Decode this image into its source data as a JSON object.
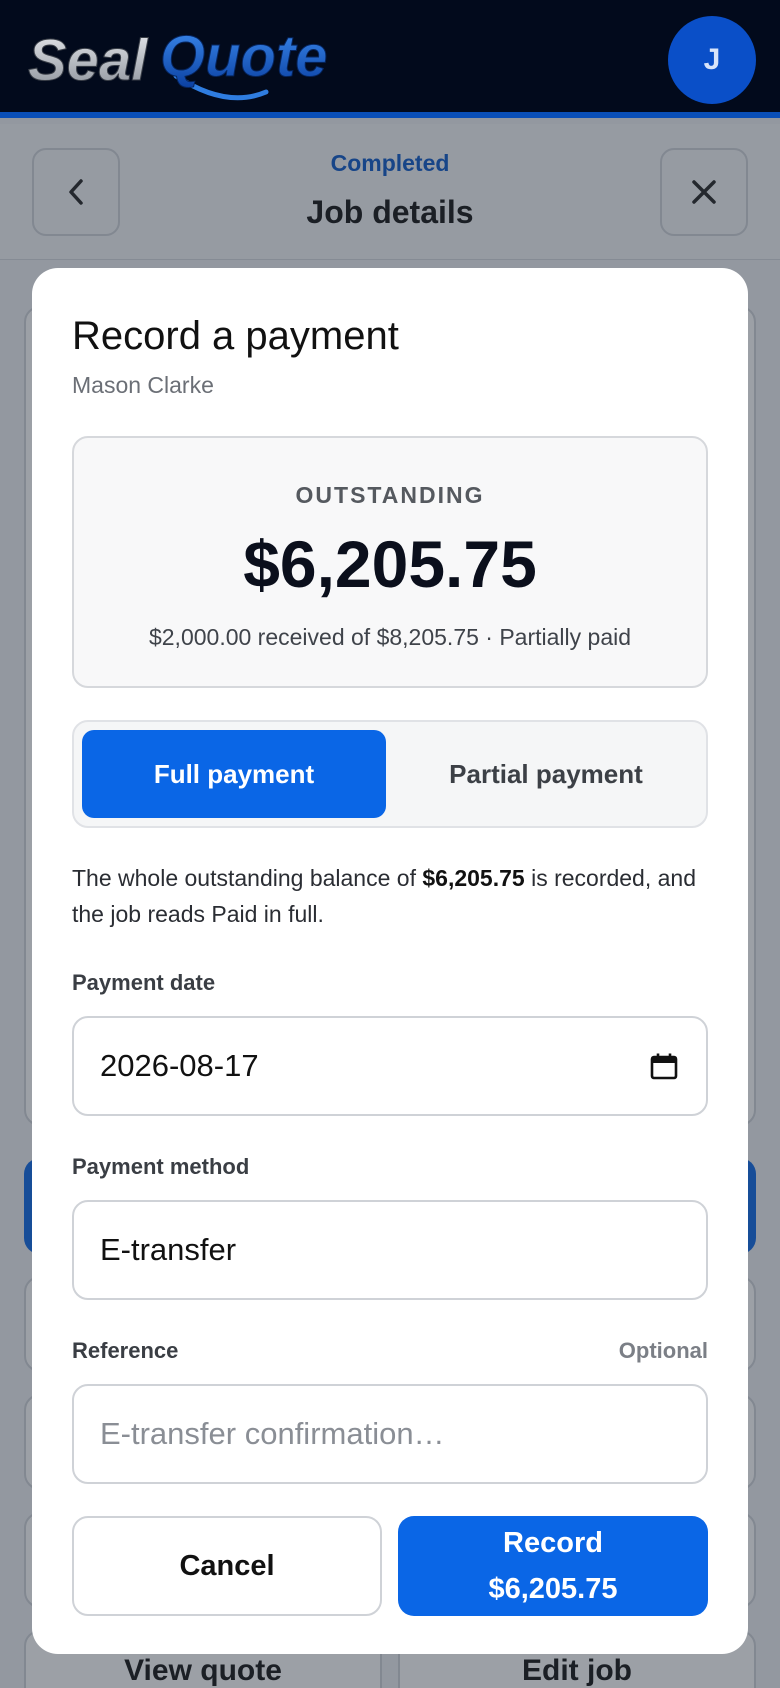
{
  "app": {
    "logo_text": "SealQuote",
    "avatar_initial": "J"
  },
  "page_header": {
    "status": "Completed",
    "title": "Job details"
  },
  "background_actions": {
    "view_quote": "View quote",
    "edit_job": "Edit job"
  },
  "modal": {
    "title": "Record a payment",
    "customer": "Mason Clarke",
    "summary": {
      "label": "OUTSTANDING",
      "amount": "$6,205.75",
      "detail": "$2,000.00 received of $8,205.75 · Partially paid"
    },
    "payment_type": {
      "options": [
        "Full payment",
        "Partial payment"
      ],
      "selected": "Full payment"
    },
    "note": {
      "before": "The whole outstanding balance of ",
      "amount": "$6,205.75",
      "after": " is recorded, and the job reads Paid in full."
    },
    "payment_date": {
      "label": "Payment date",
      "value": "2026-08-17"
    },
    "payment_method": {
      "label": "Payment method",
      "value": "E-transfer"
    },
    "reference": {
      "label": "Reference",
      "optional": "Optional",
      "placeholder": "E-transfer confirmation…"
    },
    "actions": {
      "cancel": "Cancel",
      "record_line1": "Record",
      "record_line2": "$6,205.75"
    }
  },
  "colors": {
    "brand_dark": "#020a1c",
    "accent": "#0a66e6",
    "status_blue": "#0a57c8"
  },
  "icons": [
    "chevron-left-icon",
    "close-icon",
    "calendar-icon"
  ]
}
